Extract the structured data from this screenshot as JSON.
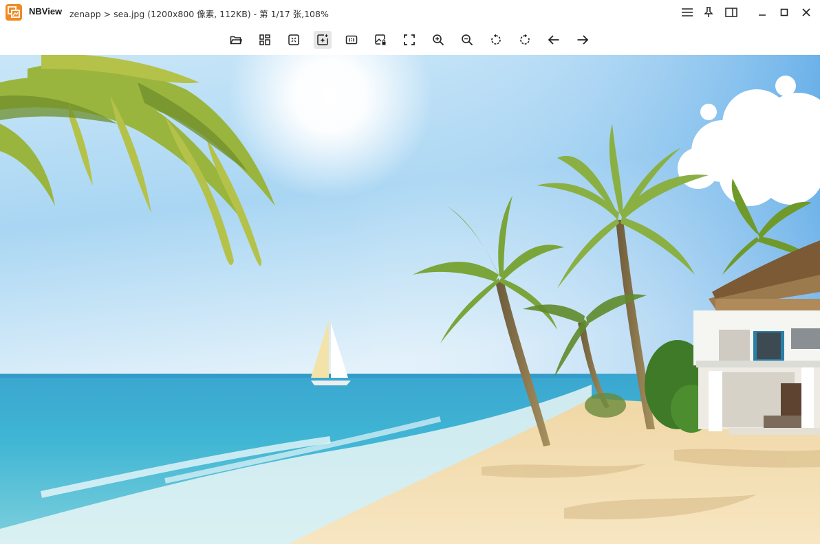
{
  "app": {
    "name": "NBView"
  },
  "title": {
    "path": "zenapp > sea.jpg (1200x800 像素, 112KB) - 第 1/17 张,108%"
  },
  "window_controls": [
    "menu-icon",
    "pin-icon",
    "sidebar-toggle-icon",
    "minimize-icon",
    "maximize-icon",
    "close-icon"
  ],
  "toolbar": {
    "buttons": [
      "open-folder",
      "thumbnails",
      "fit-to-window",
      "auto-enhance",
      "actual-size",
      "image-edit",
      "fullscreen",
      "zoom-in",
      "zoom-out",
      "rotate-left",
      "rotate-right",
      "previous-image",
      "next-image"
    ],
    "active": "auto-enhance"
  },
  "image": {
    "file": "sea.jpg",
    "width": 1200,
    "height": 800,
    "size": "112KB",
    "index": 1,
    "total": 17,
    "zoom": "108%"
  },
  "colors": {
    "accent": "#f08a24",
    "sky_top": "#2f8fe0",
    "sea": "#2aa7c9",
    "sand": "#f4dfb6",
    "palm": "#6f9a2a"
  }
}
